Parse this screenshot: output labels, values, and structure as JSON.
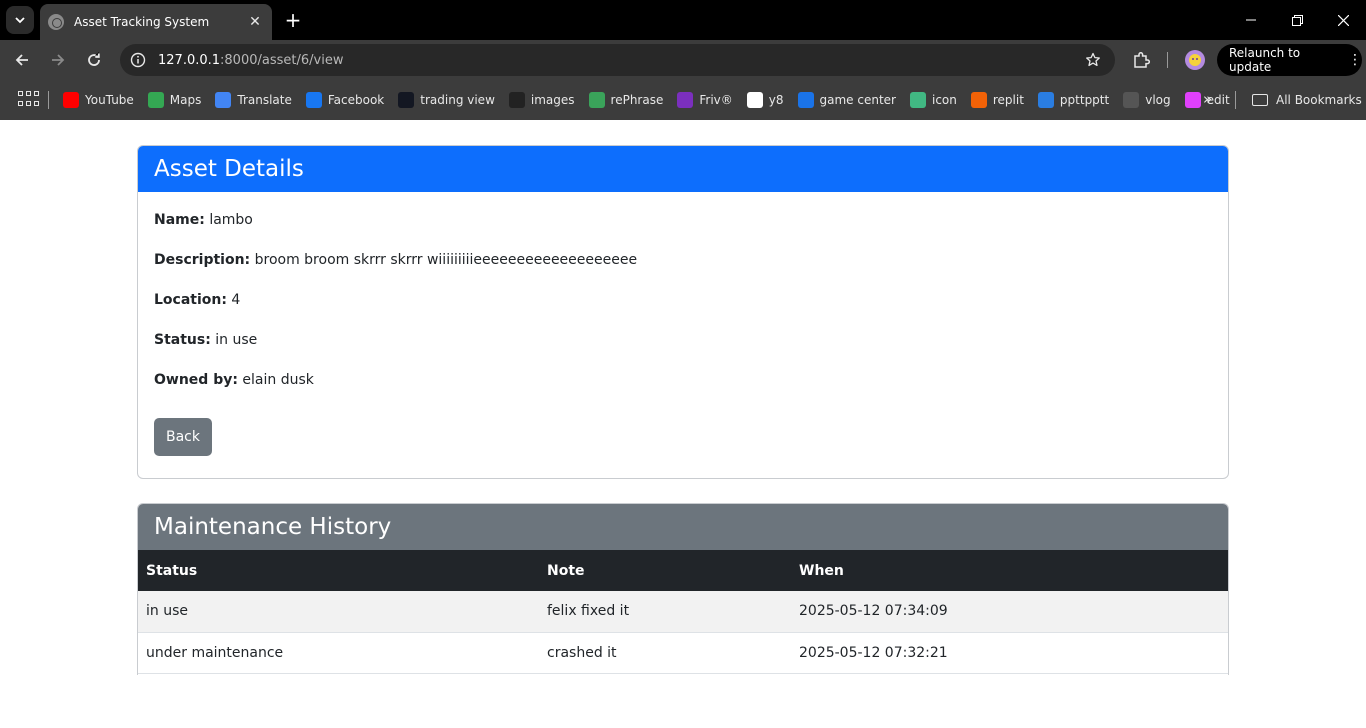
{
  "browser": {
    "tab_title": "Asset Tracking System",
    "url_host": "127.0.0.1",
    "url_path": ":8000/asset/6/view",
    "relaunch_label": "Relaunch to update",
    "bookmarks": [
      {
        "label": "YouTube",
        "icon": "youtube-icon",
        "color": "#ff0000"
      },
      {
        "label": "Maps",
        "icon": "maps-pin-icon",
        "color": "#34a853"
      },
      {
        "label": "Translate",
        "icon": "translate-icon",
        "color": "#4285f4"
      },
      {
        "label": "Facebook",
        "icon": "facebook-icon",
        "color": "#1877f2"
      },
      {
        "label": "trading view",
        "icon": "tradingview-icon",
        "color": "#131722"
      },
      {
        "label": "images",
        "icon": "images-icon",
        "color": "#222222"
      },
      {
        "label": "rePhrase",
        "icon": "rephrase-icon",
        "color": "#3aa35a"
      },
      {
        "label": "Friv®",
        "icon": "friv-icon",
        "color": "#7b2fbe"
      },
      {
        "label": "y8",
        "icon": "y8-icon",
        "color": "#ffffff"
      },
      {
        "label": "game center",
        "icon": "game-center-icon",
        "color": "#1a73e8"
      },
      {
        "label": "icon",
        "icon": "vue-icon",
        "color": "#41b883"
      },
      {
        "label": "replit",
        "icon": "replit-icon",
        "color": "#f26207"
      },
      {
        "label": "ppttpptt",
        "icon": "canva-icon",
        "color": "#2a7de1"
      },
      {
        "label": "vlog",
        "icon": "vlog-icon",
        "color": "#555555"
      },
      {
        "label": "edit",
        "icon": "play-edit-icon",
        "color": "#e040fb"
      }
    ],
    "all_bookmarks_label": "All Bookmarks"
  },
  "asset": {
    "header": "Asset Details",
    "fields": [
      {
        "label": "Name:",
        "value": "lambo"
      },
      {
        "label": "Description:",
        "value": "broom broom skrrr skrrr wiiiiiiiiieeeeeeeeeeeeeeeeeee"
      },
      {
        "label": "Location:",
        "value": "4"
      },
      {
        "label": "Status:",
        "value": "in use"
      },
      {
        "label": "Owned by:",
        "value": "elain dusk"
      }
    ],
    "back_label": "Back"
  },
  "maintenance": {
    "header": "Maintenance History",
    "columns": [
      "Status",
      "Note",
      "When"
    ],
    "rows": [
      [
        "in use",
        "felix fixed it",
        "2025-05-12 07:34:09"
      ],
      [
        "under maintenance",
        "crashed it",
        "2025-05-12 07:32:21"
      ]
    ]
  }
}
